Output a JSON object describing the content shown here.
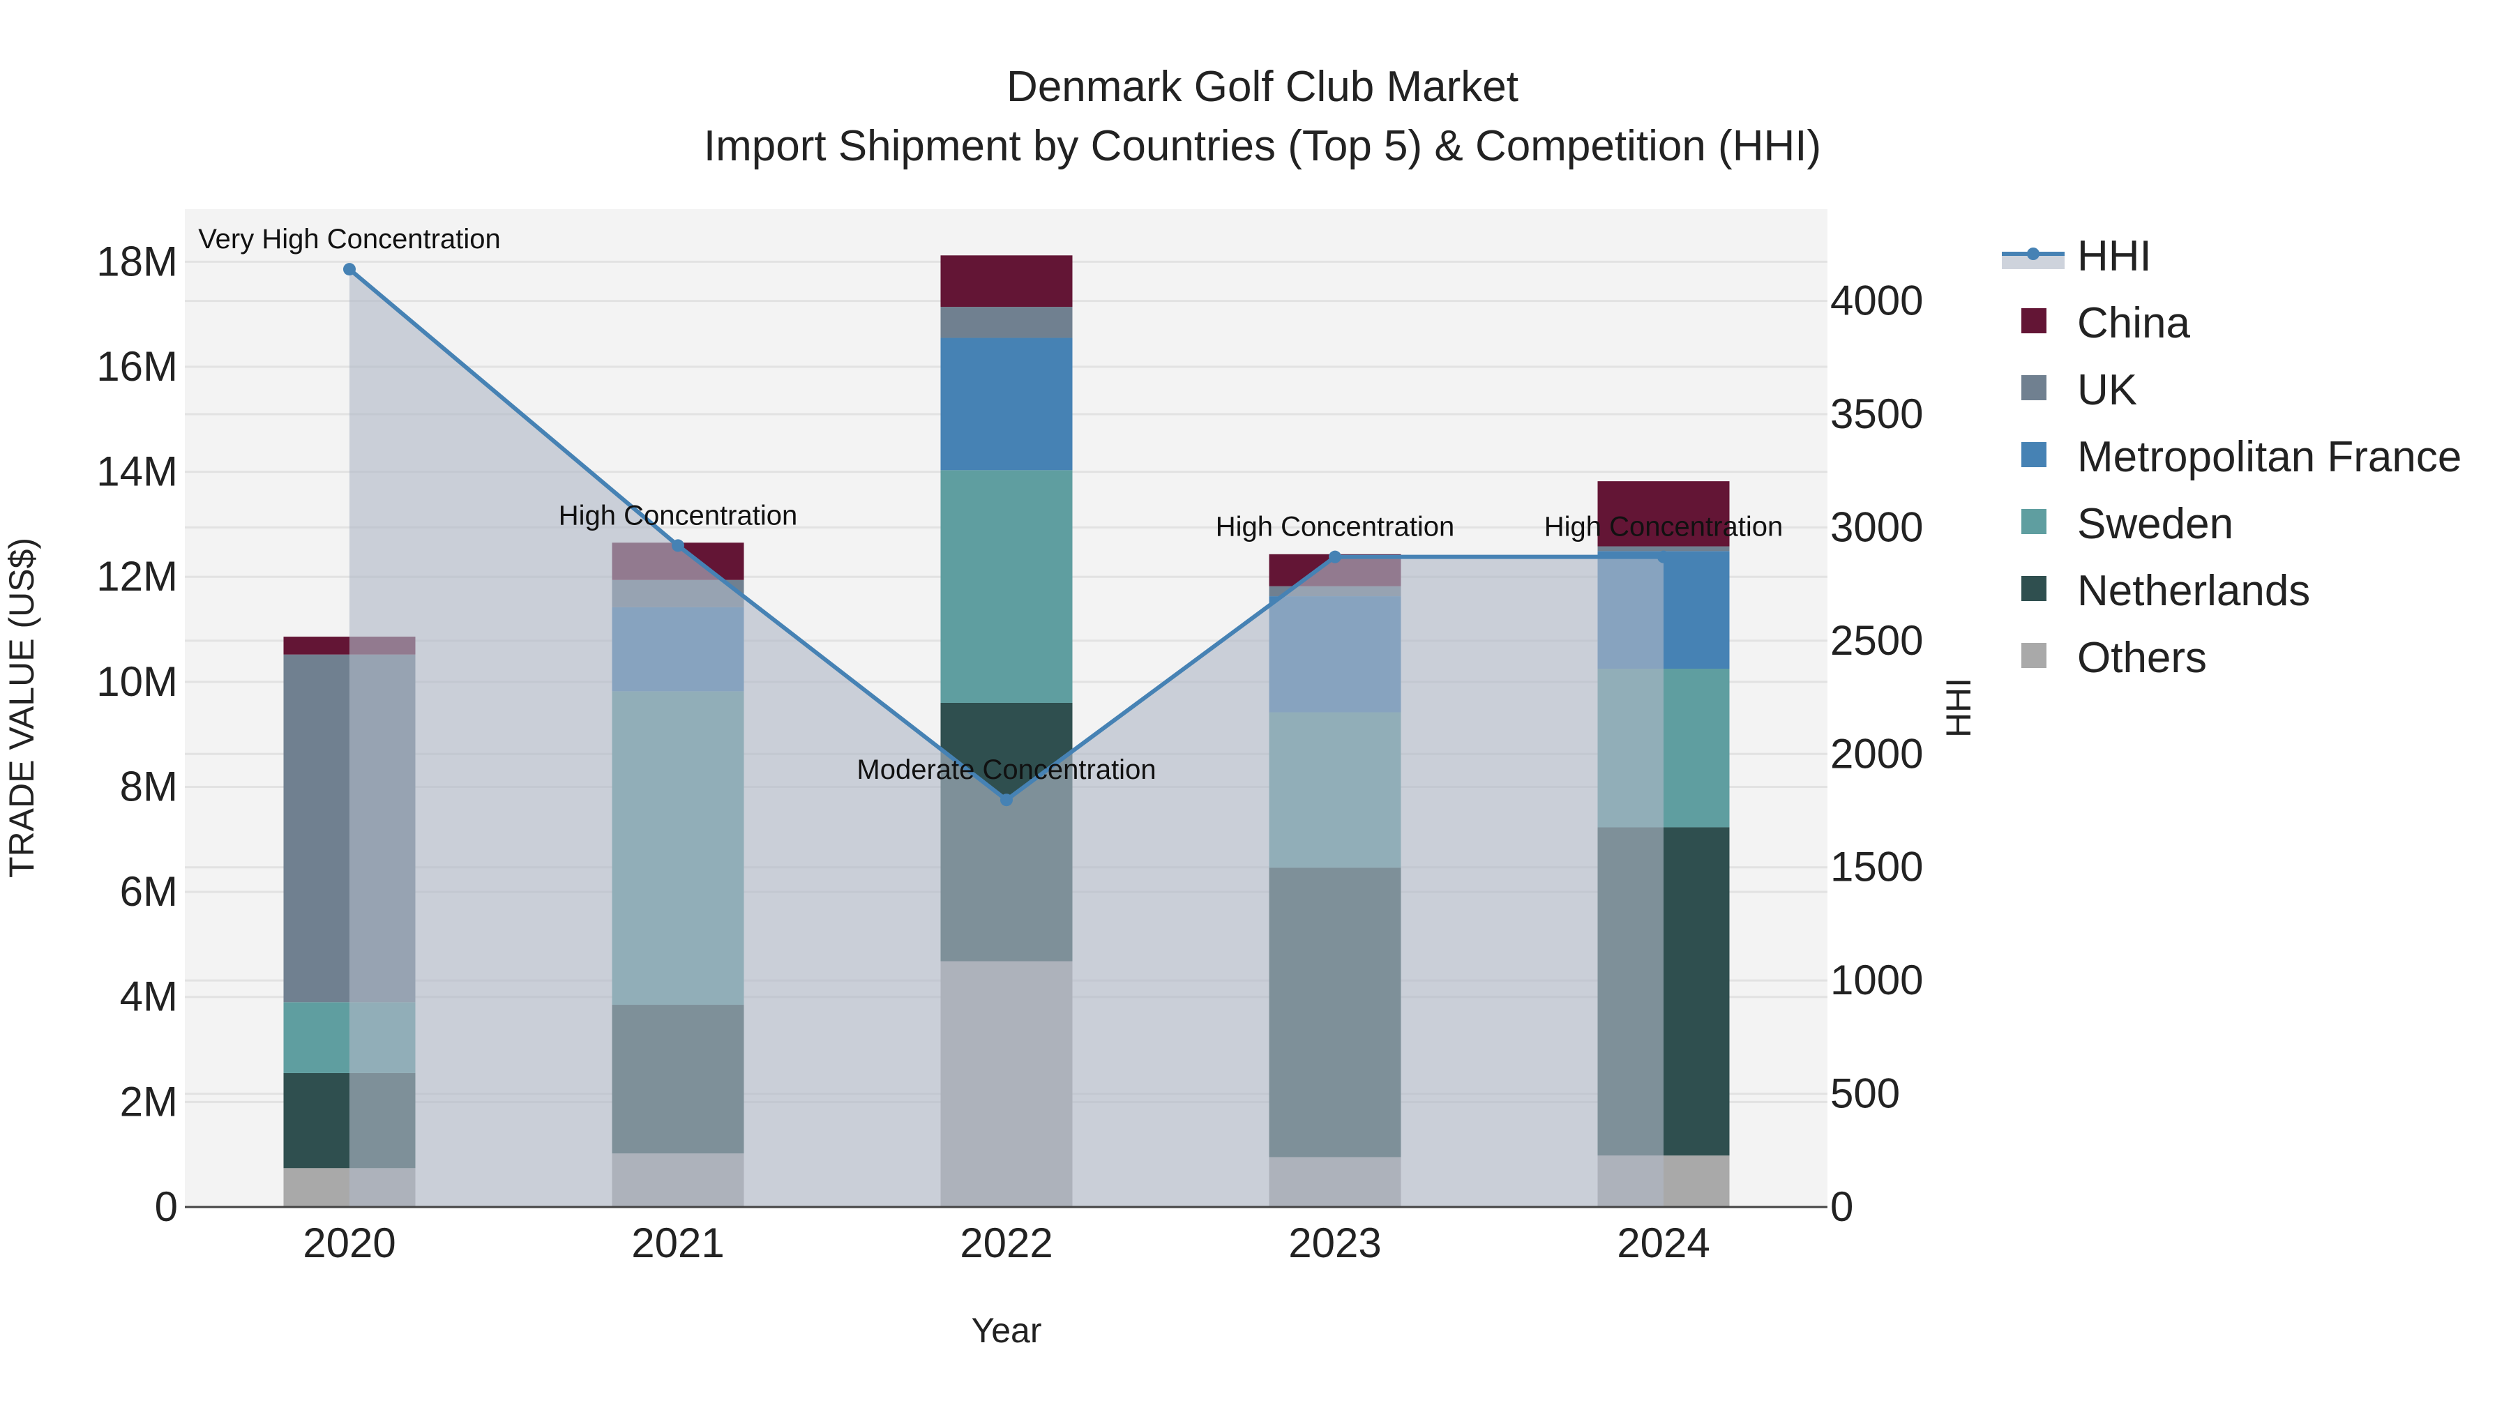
{
  "chart_data": {
    "type": "bar",
    "stacked": true,
    "title": "Denmark Golf Club Market",
    "subtitle": "Import Shipment by Countries (Top 5) & Competition (HHI)",
    "xlabel": "Year",
    "ylabel": "TRADE VALUE (US$)",
    "y2label": "HHI",
    "categories": [
      "2020",
      "2021",
      "2022",
      "2023",
      "2024"
    ],
    "ylim": [
      0,
      19000000
    ],
    "y_ticks": [
      0,
      2000000,
      4000000,
      6000000,
      8000000,
      10000000,
      12000000,
      14000000,
      16000000,
      18000000
    ],
    "y_tick_labels": [
      "0",
      "2M",
      "4M",
      "6M",
      "8M",
      "10M",
      "12M",
      "14M",
      "16M",
      "18M"
    ],
    "y2lim": [
      0,
      4405
    ],
    "y2_ticks": [
      0,
      500,
      1000,
      1500,
      2000,
      2500,
      3000,
      3500,
      4000
    ],
    "y2_tick_labels": [
      "0",
      "500",
      "1000",
      "1500",
      "2000",
      "2500",
      "3000",
      "3500",
      "4000"
    ],
    "series": [
      {
        "name": "Others",
        "color": "#a9a9a9",
        "values": [
          740000,
          1020000,
          4680000,
          950000,
          980000
        ]
      },
      {
        "name": "Netherlands",
        "color": "#2f4f4f",
        "values": [
          1810000,
          2830000,
          4920000,
          5510000,
          6250000
        ]
      },
      {
        "name": "Sweden",
        "color": "#5f9ea0",
        "values": [
          1350000,
          5970000,
          4430000,
          2960000,
          3020000
        ]
      },
      {
        "name": "Metropolitan France",
        "color": "#4682b4",
        "values": [
          0,
          1600000,
          2520000,
          2210000,
          2240000
        ]
      },
      {
        "name": "UK",
        "color": "#708090",
        "values": [
          6620000,
          520000,
          590000,
          190000,
          90000
        ]
      },
      {
        "name": "China",
        "color": "#631535",
        "values": [
          340000,
          710000,
          980000,
          610000,
          1240000
        ]
      }
    ],
    "hhi": {
      "name": "HHI",
      "color": "#4682b4",
      "values": [
        4140,
        2920,
        1797,
        2870,
        2870
      ],
      "annotations": [
        "Very High Concentration",
        "High Concentration",
        "Moderate Concentration",
        "High Concentration",
        "High Concentration"
      ]
    },
    "legend_order": [
      "HHI",
      "China",
      "UK",
      "Metropolitan France",
      "Sweden",
      "Netherlands",
      "Others"
    ],
    "legend_placement": "right",
    "grid": true
  }
}
